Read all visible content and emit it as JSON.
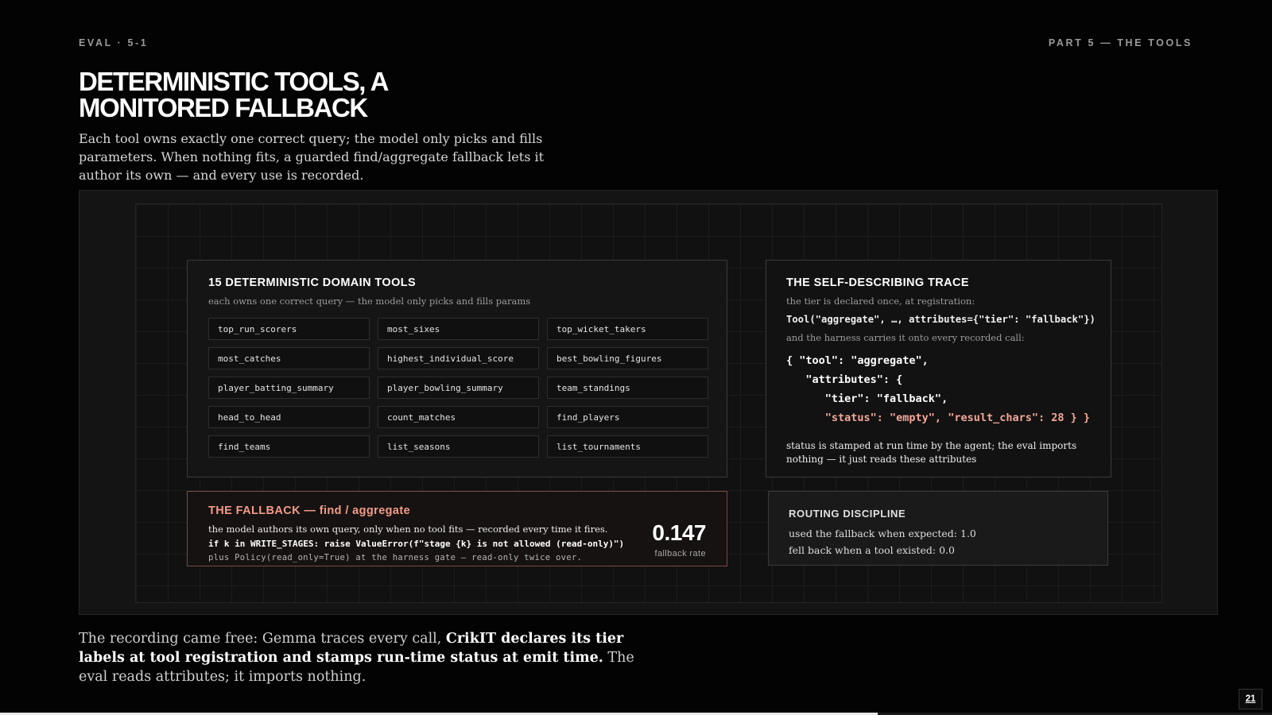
{
  "header": {
    "eyebrow_left": "EVAL · 5-1",
    "eyebrow_right": "PART 5 — THE TOOLS",
    "title_line1": "DETERMINISTIC TOOLS, A",
    "title_line2": "MONITORED FALLBACK",
    "lede": "Each tool owns exactly one correct query; the model only picks and fills parameters. When nothing fits, a guarded find/aggregate fallback lets it author its own — and every use is recorded."
  },
  "tools_card": {
    "heading": "15 DETERMINISTIC DOMAIN TOOLS",
    "subheading": "each owns one correct query — the model only picks and fills params",
    "tools": [
      "top_run_scorers",
      "most_sixes",
      "top_wicket_takers",
      "most_catches",
      "highest_individual_score",
      "best_bowling_figures",
      "player_batting_summary",
      "player_bowling_summary",
      "team_standings",
      "head_to_head",
      "count_matches",
      "find_players",
      "find_teams",
      "list_seasons",
      "list_tournaments"
    ]
  },
  "trace_card": {
    "heading": "THE SELF-DESCRIBING TRACE",
    "line1": "the tier is declared once, at registration:",
    "registration": "Tool(\"aggregate\", …, attributes={\"tier\": \"fallback\"})",
    "line2": "and the harness carries it onto every recorded call:",
    "json_l1": "{ \"tool\": \"aggregate\",",
    "json_l2": "   \"attributes\": {",
    "json_l3": "      \"tier\": \"fallback\",",
    "json_l4": "      \"status\": \"empty\", \"result_chars\": 28 } }",
    "note": "status is stamped at run time by the agent; the eval imports nothing — it just reads these attributes"
  },
  "fallback_card": {
    "heading": "THE FALLBACK — find / aggregate",
    "line1": "the model authors its own query, only when no tool fits — recorded every time it fires.",
    "code": "if k in WRITE_STAGES: raise ValueError(f\"stage {k} is not allowed (read-only)\")",
    "line3": "plus Policy(read_only=True) at the harness gate — read-only twice over.",
    "metric_value": "0.147",
    "metric_label": "fallback rate"
  },
  "routing_card": {
    "heading": "ROUTING DISCIPLINE",
    "line1": "used the fallback when expected: 1.0",
    "line2": "fell back when a tool existed: 0.0"
  },
  "footer": {
    "part1": "The recording came free: Gemma traces every call, ",
    "bold": "CrikIT declares its tier labels at tool registration and stamps run-time status at emit time.",
    "part2": " The eval reads attributes; it imports nothing."
  },
  "page": {
    "number": "21",
    "progress": 0.69
  },
  "colors": {
    "background": "#030303",
    "accent": "#f39b87",
    "fallback_border": "#7a4a40"
  }
}
